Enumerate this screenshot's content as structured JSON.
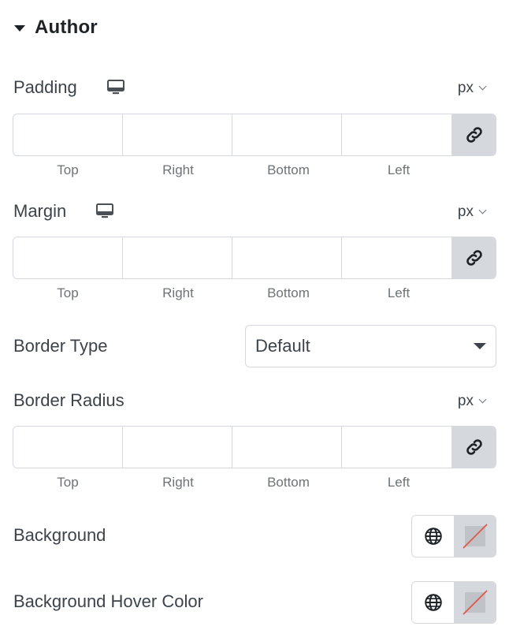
{
  "section": {
    "title": "Author"
  },
  "padding": {
    "label": "Padding",
    "unit": "px",
    "fields": [
      "Top",
      "Right",
      "Bottom",
      "Left"
    ]
  },
  "margin": {
    "label": "Margin",
    "unit": "px",
    "fields": [
      "Top",
      "Right",
      "Bottom",
      "Left"
    ]
  },
  "border_type": {
    "label": "Border Type",
    "value": "Default"
  },
  "border_radius": {
    "label": "Border Radius",
    "unit": "px",
    "fields": [
      "Top",
      "Right",
      "Bottom",
      "Left"
    ]
  },
  "background": {
    "label": "Background"
  },
  "background_hover": {
    "label": "Background Hover Color"
  },
  "icons": {
    "section_toggle": "caret-down-icon",
    "device": "desktop-icon",
    "unit_dropdown": "chevron-down-icon",
    "link": "link-icon",
    "select_arrow": "caret-down-icon",
    "global": "globe-icon",
    "empty_color": "no-color-icon"
  },
  "colors": {
    "border": "#d5d8dc",
    "text": "#3c434a",
    "muted": "#6d7378",
    "accent_red": "#e2574c"
  }
}
